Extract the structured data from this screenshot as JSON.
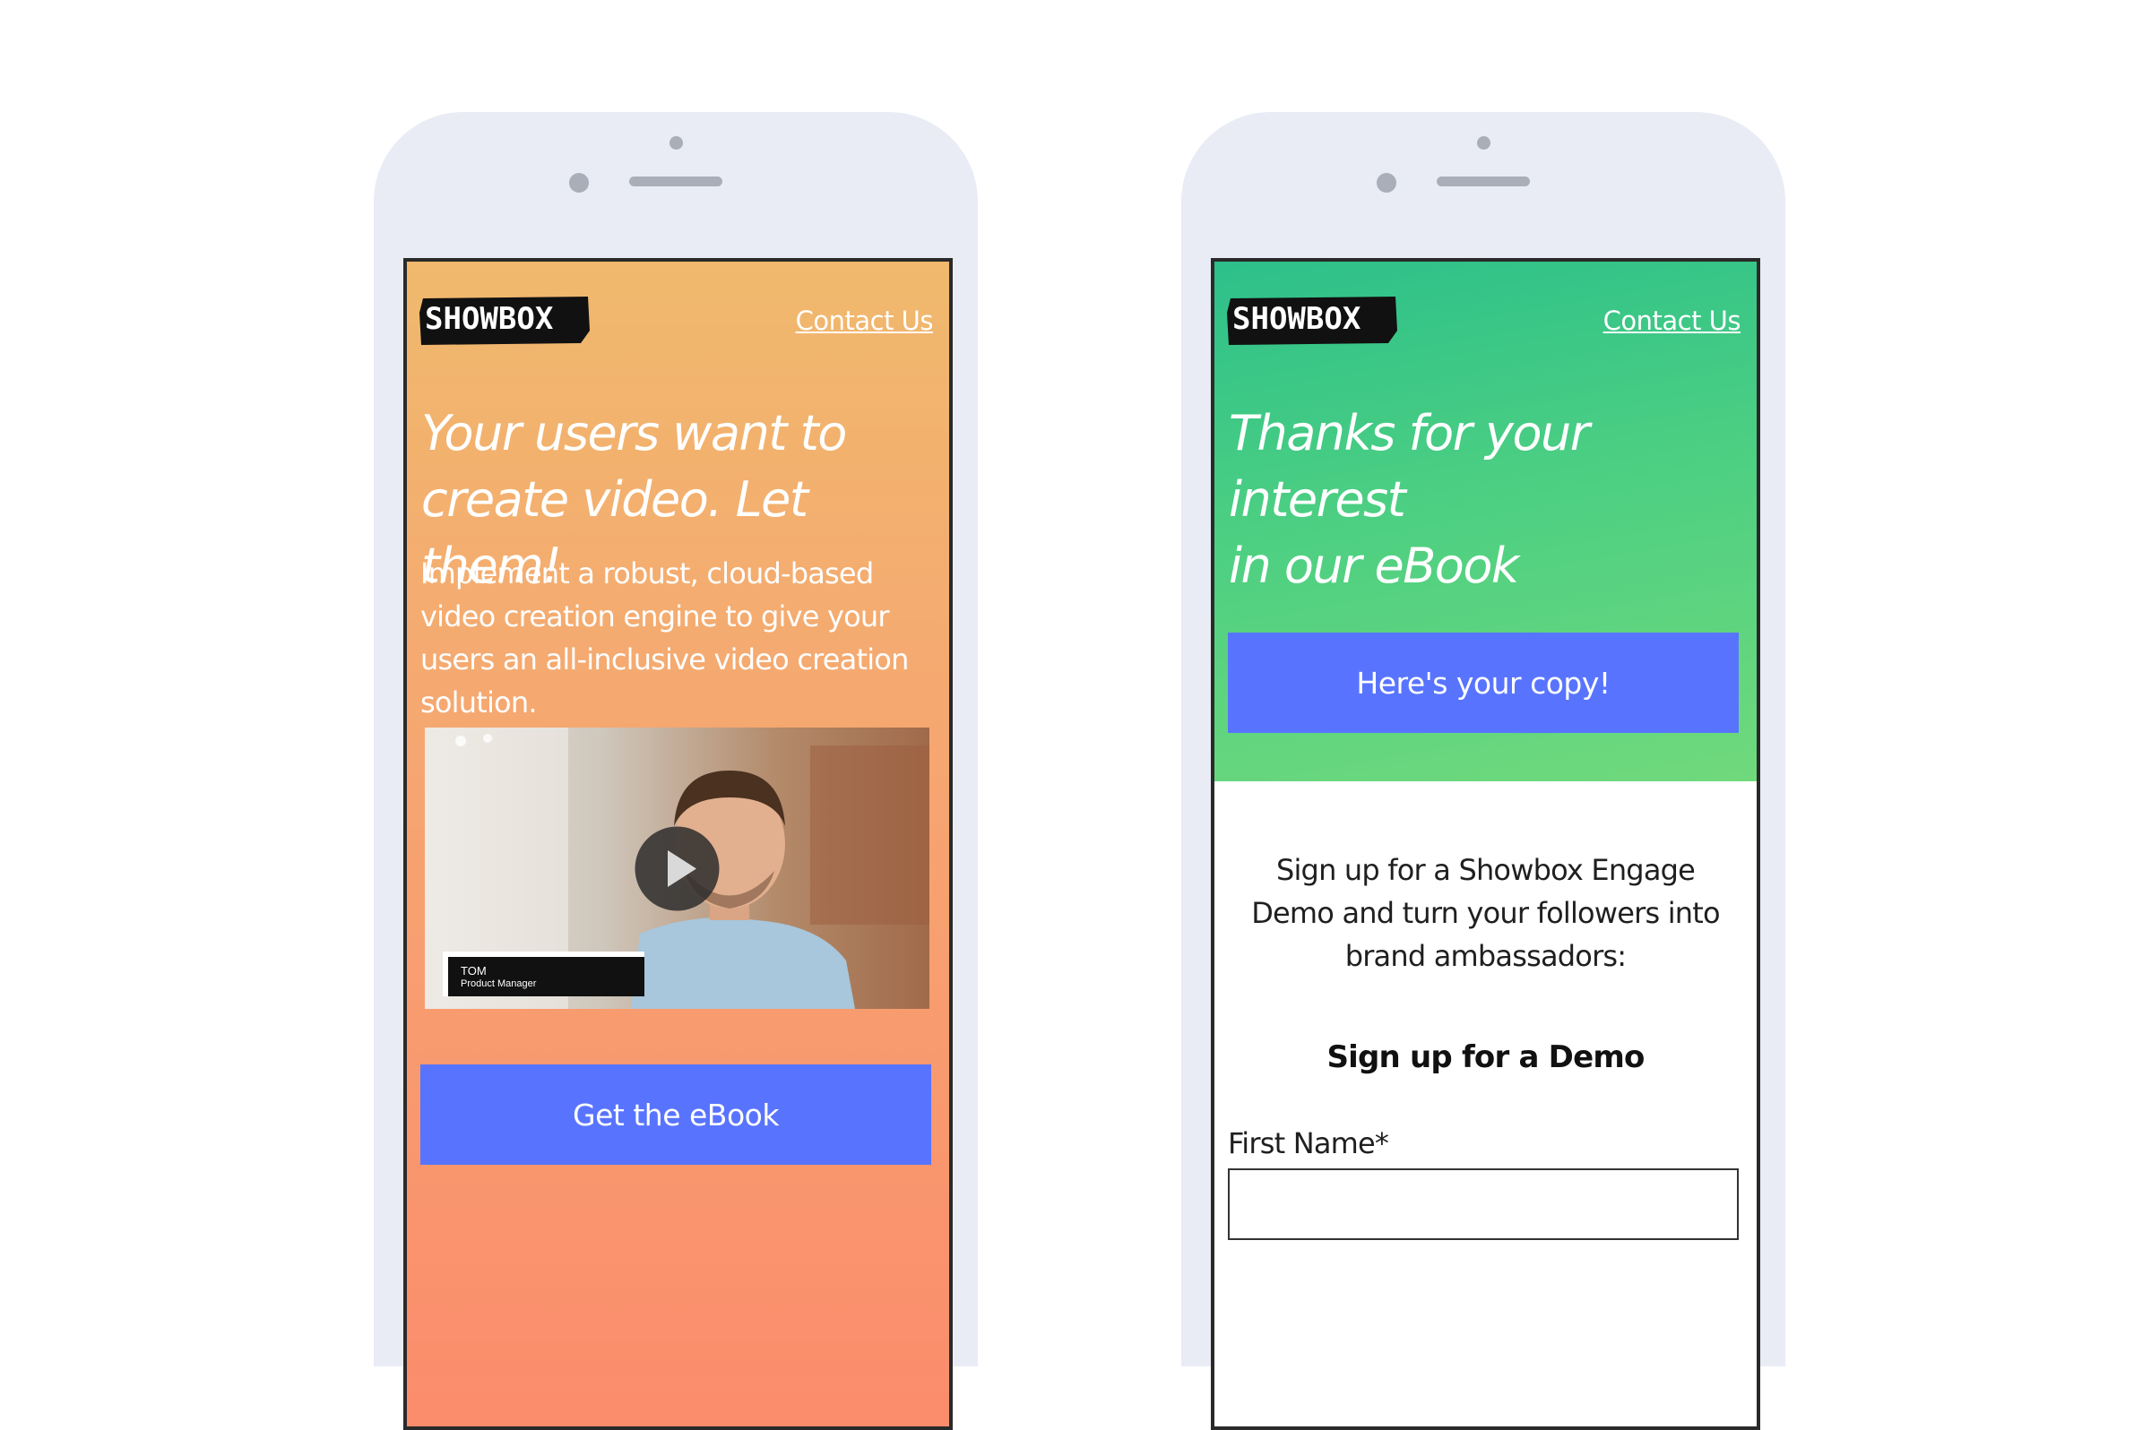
{
  "brand": {
    "logo_text": "SHOWBOX"
  },
  "left_phone": {
    "contact_link": "Contact Us",
    "headline_line1": "Your users want to",
    "headline_line2": "create video. Let them!",
    "subtext": "Implement a robust, cloud-based video creation engine to give your users an all-inclusive video creation solution.",
    "video": {
      "name_tag": "TOM",
      "role_tag": "Product Manager"
    },
    "cta_label": "Get the eBook"
  },
  "right_phone": {
    "contact_link": "Contact Us",
    "headline_line1": "Thanks for your interest",
    "headline_line2": "in our eBook",
    "cta_label": "Here's your copy!",
    "pitch": "Sign up for a Showbox Engage Demo and turn your followers into brand ambassadors:",
    "form_title": "Sign up for a Demo",
    "first_name_label": "First Name*",
    "first_name_value": ""
  },
  "colors": {
    "cta_blue": "#5874ff",
    "orange_top": "#f0b96d",
    "orange_bottom": "#fb8c6c",
    "green_top": "#2dc08a",
    "green_bottom": "#70d97c",
    "phone_body": "#e9ecf4"
  }
}
